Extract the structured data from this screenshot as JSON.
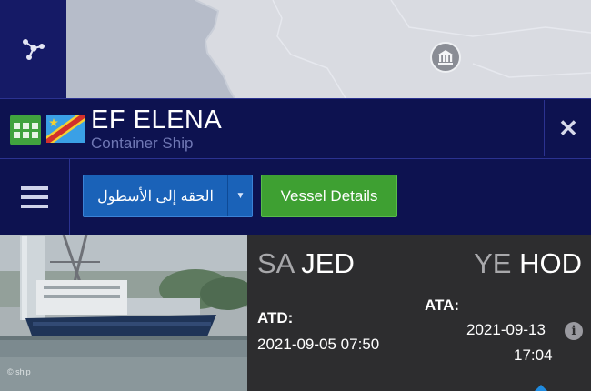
{
  "vessel": {
    "name": "EF ELENA",
    "type": "Container Ship"
  },
  "toolbar": {
    "fleet_label": "الحقه إلى الأسطول",
    "details_label": "Vessel Details"
  },
  "voyage": {
    "departure": {
      "country": "SA",
      "port": "JED"
    },
    "arrival": {
      "country": "YE",
      "port": "HOD"
    },
    "atd_label": "ATD:",
    "atd_value": "2021-09-05 07:50",
    "ata_label": "ATA:",
    "ata_date": "2021-09-13",
    "ata_time": "17:04"
  },
  "photo": {
    "credit": "© ship"
  },
  "icons": {
    "map_tool": "share-nodes-icon",
    "poi": "bank-icon",
    "apps": "grid-icon",
    "flag": "flag-icon",
    "close": "close-icon",
    "menu": "hamburger-menu-icon",
    "dropdown": "caret-down-icon",
    "info": "info-icon"
  },
  "colors": {
    "header_bg": "#0d1250",
    "fleet_button": "#1a62b8",
    "details_button": "#3ea032",
    "info_panel": "#2d2d2f"
  }
}
